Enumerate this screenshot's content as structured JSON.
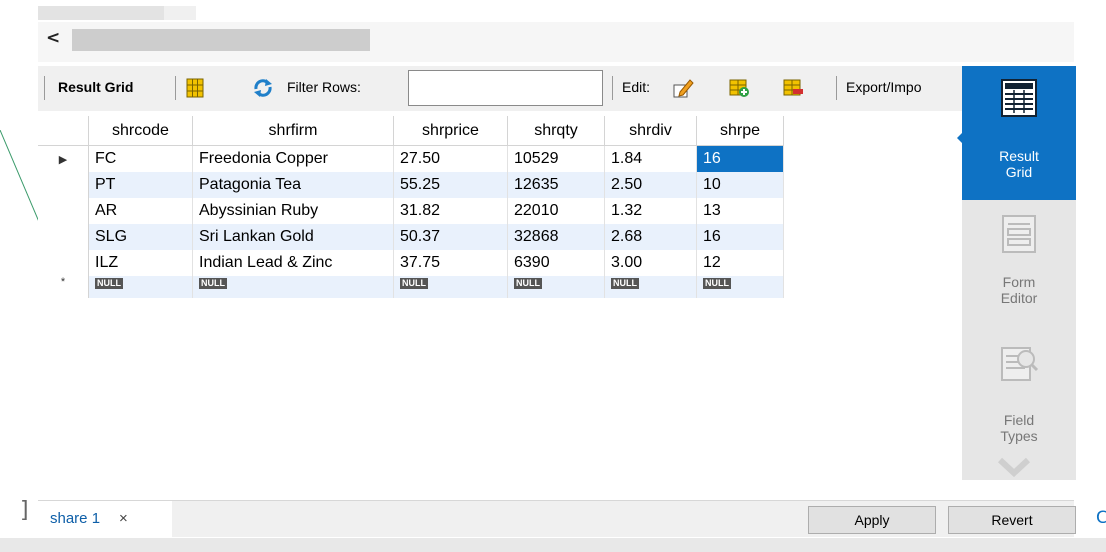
{
  "toolbar": {
    "result_grid_label": "Result Grid",
    "filter_rows_label": "Filter Rows:",
    "filter_value": "",
    "edit_label": "Edit:",
    "export_label": "Export/Impo"
  },
  "grid": {
    "columns": [
      "shrcode",
      "shrfirm",
      "shrprice",
      "shrqty",
      "shrdiv",
      "shrpe"
    ],
    "rows": [
      [
        "FC",
        "Freedonia Copper",
        "27.50",
        "10529",
        "1.84",
        "16"
      ],
      [
        "PT",
        "Patagonia Tea",
        "55.25",
        "12635",
        "2.50",
        "10"
      ],
      [
        "AR",
        "Abyssinian Ruby",
        "31.82",
        "22010",
        "1.32",
        "13"
      ],
      [
        "SLG",
        "Sri Lankan Gold",
        "50.37",
        "32868",
        "2.68",
        "16"
      ],
      [
        "ILZ",
        "Indian Lead & Zinc",
        "37.75",
        "6390",
        "3.00",
        "12"
      ]
    ],
    "null_label": "NULL",
    "current_row_marker": "▶",
    "new_row_marker": "*"
  },
  "sidebar": {
    "result_grid_line1": "Result",
    "result_grid_line2": "Grid",
    "form_editor_line1": "Form",
    "form_editor_line2": "Editor",
    "field_types_line1": "Field",
    "field_types_line2": "Types"
  },
  "bottom": {
    "tab_name": "share 1",
    "tab_close": "×",
    "apply_label": "Apply",
    "revert_label": "Revert",
    "right_edge_char": "C",
    "left_edge_char": "]"
  },
  "scroll": {
    "left_arrow": "<"
  },
  "colors": {
    "accent": "#0e72c4",
    "alt_row": "#e9f1fc"
  }
}
